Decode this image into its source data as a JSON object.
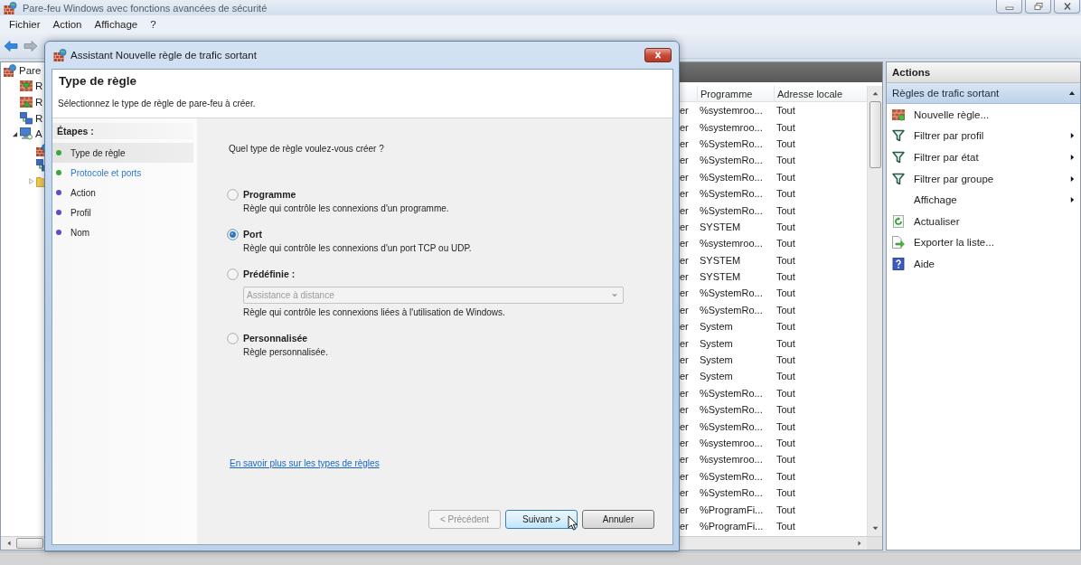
{
  "window": {
    "title": "Pare-feu Windows avec fonctions avancées de sécurité"
  },
  "menu": [
    "Fichier",
    "Action",
    "Affichage",
    "?"
  ],
  "tree": {
    "items": [
      {
        "label": "Pare",
        "kind": "firewall",
        "children": [
          {
            "label": "R",
            "kind": "inbound"
          },
          {
            "label": "R",
            "kind": "outbound"
          },
          {
            "label": "R",
            "kind": "network"
          },
          {
            "label": "A",
            "kind": "monitor",
            "expanded": true,
            "children": [
              {
                "kind": "firewall"
              },
              {
                "kind": "network"
              },
              {
                "kind": "folder",
                "expanded": false
              }
            ]
          }
        ]
      }
    ]
  },
  "rules_table": {
    "columns": [
      "Programme",
      "Adresse locale"
    ],
    "rows": [
      {
        "column_1": "er",
        "cells": [
          "%systemroo...",
          "Tout"
        ]
      },
      {
        "column_1": "er",
        "cells": [
          "%systemroo...",
          "Tout"
        ]
      },
      {
        "column_1": "er",
        "cells": [
          "%SystemRo...",
          "Tout"
        ]
      },
      {
        "column_1": "er",
        "cells": [
          "%SystemRo...",
          "Tout"
        ]
      },
      {
        "column_1": "er",
        "cells": [
          "%SystemRo...",
          "Tout"
        ]
      },
      {
        "column_1": "er",
        "cells": [
          "%SystemRo...",
          "Tout"
        ]
      },
      {
        "column_1": "er",
        "cells": [
          "%SystemRo...",
          "Tout"
        ]
      },
      {
        "column_1": "er",
        "cells": [
          "SYSTEM",
          "Tout"
        ]
      },
      {
        "column_1": "er",
        "cells": [
          "%systemroo...",
          "Tout"
        ]
      },
      {
        "column_1": "er",
        "cells": [
          "SYSTEM",
          "Tout"
        ]
      },
      {
        "column_1": "er",
        "cells": [
          "SYSTEM",
          "Tout"
        ]
      },
      {
        "column_1": "er",
        "cells": [
          "%SystemRo...",
          "Tout"
        ]
      },
      {
        "column_1": "er",
        "cells": [
          "%SystemRo...",
          "Tout"
        ]
      },
      {
        "column_1": "er",
        "cells": [
          "System",
          "Tout"
        ]
      },
      {
        "column_1": "er",
        "cells": [
          "System",
          "Tout"
        ]
      },
      {
        "column_1": "er",
        "cells": [
          "System",
          "Tout"
        ]
      },
      {
        "column_1": "er",
        "cells": [
          "System",
          "Tout"
        ]
      },
      {
        "column_1": "er",
        "cells": [
          "%SystemRo...",
          "Tout"
        ]
      },
      {
        "column_1": "er",
        "cells": [
          "%SystemRo...",
          "Tout"
        ]
      },
      {
        "column_1": "er",
        "cells": [
          "%SystemRo...",
          "Tout"
        ]
      },
      {
        "column_1": "er",
        "cells": [
          "%systemroo...",
          "Tout"
        ]
      },
      {
        "column_1": "er",
        "cells": [
          "%systemroo...",
          "Tout"
        ]
      },
      {
        "column_1": "er",
        "cells": [
          "%SystemRo...",
          "Tout"
        ]
      },
      {
        "column_1": "er",
        "cells": [
          "%SystemRo...",
          "Tout"
        ]
      },
      {
        "column_1": "er",
        "cells": [
          "%ProgramFi...",
          "Tout"
        ]
      },
      {
        "column_1": "er",
        "cells": [
          "%ProgramFi...",
          "Tout"
        ]
      }
    ]
  },
  "actions_pane": {
    "title": "Actions",
    "section": {
      "label": "Règles de trafic sortant",
      "expanded": true
    },
    "items": [
      {
        "label": "Nouvelle règle...",
        "kind": "new-rule",
        "submenu": false
      },
      {
        "label": "Filtrer par profil",
        "kind": "filter",
        "submenu": true
      },
      {
        "label": "Filtrer par état",
        "kind": "filter",
        "submenu": true
      },
      {
        "label": "Filtrer par groupe",
        "kind": "filter",
        "submenu": true
      },
      {
        "label": "Affichage",
        "kind": "plain",
        "submenu": true
      },
      {
        "label": "Actualiser",
        "kind": "refresh",
        "submenu": false
      },
      {
        "label": "Exporter la liste...",
        "kind": "export",
        "submenu": false
      },
      {
        "label": "Aide",
        "kind": "help",
        "submenu": false
      }
    ]
  },
  "dialog": {
    "title": "Assistant Nouvelle règle de trafic sortant",
    "heading": "Type de règle",
    "subtitle": "Sélectionnez le type de règle de pare-feu à créer.",
    "steps_title": "Étapes :",
    "steps": [
      {
        "label": "Type de règle",
        "color": "#3ca83c",
        "selected": true,
        "hovered": false
      },
      {
        "label": "Protocole et ports",
        "color": "#3ca83c",
        "selected": false,
        "hovered": true
      },
      {
        "label": "Action",
        "color": "#5a4fc4",
        "selected": false,
        "hovered": false
      },
      {
        "label": "Profil",
        "color": "#5a4fc4",
        "selected": false,
        "hovered": false
      },
      {
        "label": "Nom",
        "color": "#5a4fc4",
        "selected": false,
        "hovered": false
      }
    ],
    "question": "Quel type de règle voulez-vous créer ?",
    "options": [
      {
        "label": "Programme",
        "description": "Règle qui contrôle les connexions d'un programme.",
        "selected": false
      },
      {
        "label": "Port",
        "description": "Règle qui contrôle les connexions d'un port TCP ou UDP.",
        "selected": true
      },
      {
        "label": "Prédéfinie :",
        "description": "Règle qui contrôle les connexions liées à l'utilisation de Windows.",
        "selected": false,
        "dropdown": {
          "value": "Assistance à distance",
          "disabled": true
        }
      },
      {
        "label": "Personnalisée",
        "description": "Règle personnalisée.",
        "selected": false
      }
    ],
    "help_link": "En savoir plus sur les types de règles",
    "buttons": [
      {
        "label": "< Précédent",
        "disabled": true,
        "focused": false
      },
      {
        "label": "Suivant >",
        "disabled": false,
        "focused": true
      },
      {
        "label": "Annuler",
        "disabled": false,
        "focused": false
      }
    ]
  }
}
